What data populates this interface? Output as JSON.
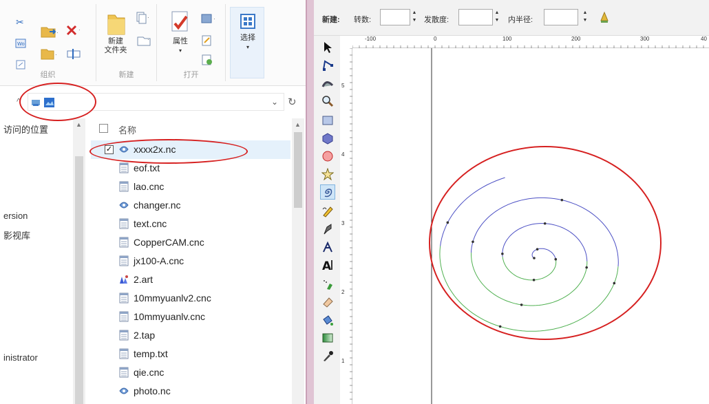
{
  "ribbon": {
    "groups": [
      {
        "label": "组织"
      },
      {
        "label": "新建"
      },
      {
        "label": "打开"
      }
    ],
    "new_folder_label": "新建\n文件夹",
    "properties_label": "属性",
    "select_label": "选择"
  },
  "address_bar": {
    "refresh_icon": "refresh-icon",
    "dropdown_icon": "chevron-down-icon"
  },
  "nav_pane": {
    "items": [
      "访问的位置",
      "ersion",
      "影视库",
      "inistrator"
    ]
  },
  "file_list": {
    "column_name": "名称",
    "files": [
      {
        "name": "xxxx2x.nc",
        "type": "nc",
        "checked": true
      },
      {
        "name": "eof.txt",
        "type": "doc"
      },
      {
        "name": "lao.cnc",
        "type": "doc"
      },
      {
        "name": "changer.nc",
        "type": "nc"
      },
      {
        "name": "text.cnc",
        "type": "doc"
      },
      {
        "name": "CopperCAM.cnc",
        "type": "doc"
      },
      {
        "name": "jx100-A.cnc",
        "type": "doc"
      },
      {
        "name": "2.art",
        "type": "art"
      },
      {
        "name": "10mmyuanlv2.cnc",
        "type": "doc"
      },
      {
        "name": "10mmyuanlv.cnc",
        "type": "doc"
      },
      {
        "name": "2.tap",
        "type": "doc"
      },
      {
        "name": "temp.txt",
        "type": "doc"
      },
      {
        "name": "qie.cnc",
        "type": "doc"
      },
      {
        "name": "photo.nc",
        "type": "nc"
      }
    ]
  },
  "cam_props": {
    "new_label": "新建:",
    "turns_label": "转数:",
    "divergence_label": "发散度:",
    "inner_radius_label": "内半径:",
    "turns_value": "",
    "divergence_value": "",
    "inner_radius_value": ""
  },
  "rulers": {
    "h_ticks": [
      "-100",
      "0",
      "100",
      "200",
      "300",
      "40"
    ],
    "v_ticks": [
      "5",
      "4",
      "3",
      "2",
      "1"
    ]
  },
  "tools": [
    "selector-icon",
    "node-edit-icon",
    "tweak-icon",
    "zoom-icon",
    "rect-icon",
    "3dbox-icon",
    "ellipse-icon",
    "star-icon",
    "spiral-icon",
    "pencil-icon",
    "pen-icon",
    "calligraphy-icon",
    "text-icon",
    "spray-icon",
    "eraser-icon",
    "bucket-icon",
    "gradient-icon",
    "dropper-icon"
  ],
  "colors": {
    "annotation": "#d62020",
    "spiral_blue": "#4b4fc4",
    "spiral_green": "#4fb050",
    "selected_row": "#e5f1fb"
  }
}
